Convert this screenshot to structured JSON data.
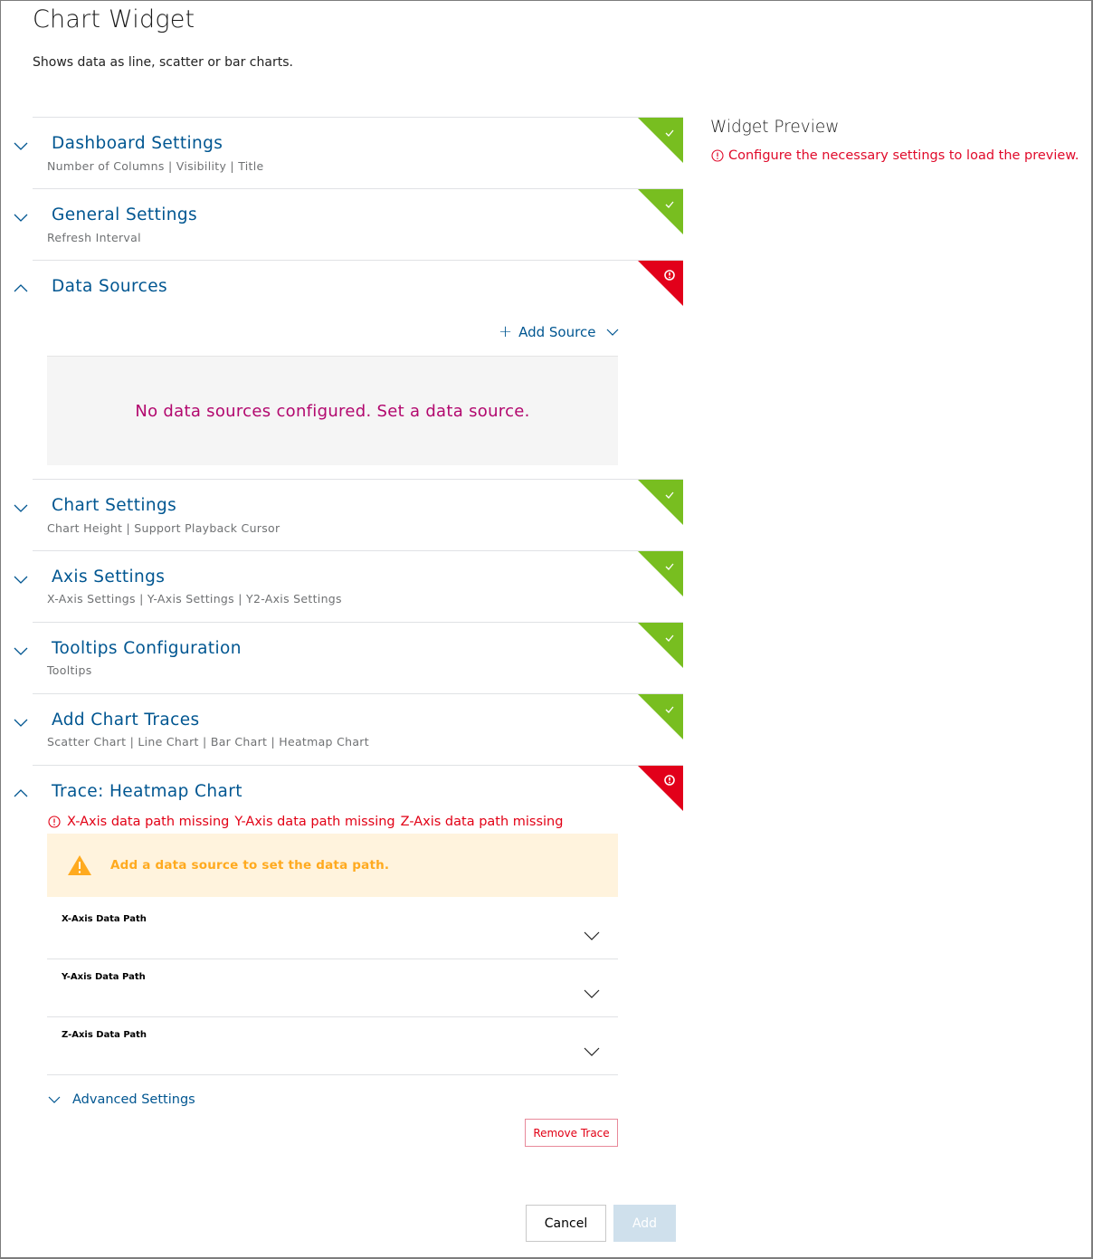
{
  "page": {
    "title": "Chart Widget",
    "subtitle": "Shows data as line, scatter or bar charts."
  },
  "colors": {
    "accent": "#005691",
    "success": "#78be20",
    "error": "#e20015",
    "warning": "#ffaa1f",
    "empty_message": "#b2076e"
  },
  "sections": [
    {
      "title": "Dashboard Settings",
      "subtitle": "Number of Columns | Visibility | Title",
      "expanded": false,
      "status": "valid",
      "status_icon": "check-icon"
    },
    {
      "title": "General Settings",
      "subtitle": "Refresh Interval",
      "expanded": false,
      "status": "valid",
      "status_icon": "check-icon"
    },
    {
      "title": "Data Sources",
      "subtitle": "",
      "expanded": true,
      "status": "error",
      "status_icon": "exclamation-icon"
    },
    {
      "title": "Chart Settings",
      "subtitle": "Chart Height | Support Playback Cursor",
      "expanded": false,
      "status": "valid",
      "status_icon": "check-icon"
    },
    {
      "title": "Axis Settings",
      "subtitle": "X-Axis Settings | Y-Axis Settings | Y2-Axis Settings",
      "expanded": false,
      "status": "valid",
      "status_icon": "check-icon"
    },
    {
      "title": "Tooltips Configuration",
      "subtitle": "Tooltips",
      "expanded": false,
      "status": "valid",
      "status_icon": "check-icon"
    },
    {
      "title": "Add Chart Traces",
      "subtitle": "Scatter Chart | Line Chart | Bar Chart | Heatmap Chart",
      "expanded": false,
      "status": "valid",
      "status_icon": "check-icon"
    },
    {
      "title": "Trace: Heatmap Chart",
      "subtitle": "",
      "expanded": true,
      "status": "error",
      "status_icon": "exclamation-icon"
    }
  ],
  "data_sources": {
    "add_source_label": "Add Source",
    "empty_message": "No data sources configured. Set a data source."
  },
  "trace": {
    "errors": [
      "X-Axis data path missing",
      "Y-Axis data path missing",
      "Z-Axis data path missing"
    ],
    "warning": "Add a data source to set the data path.",
    "fields": [
      {
        "label": "X-Axis Data Path",
        "value": ""
      },
      {
        "label": "Y-Axis Data Path",
        "value": ""
      },
      {
        "label": "Z-Axis Data Path",
        "value": ""
      }
    ],
    "advanced_label": "Advanced Settings",
    "remove_label": "Remove Trace"
  },
  "preview": {
    "title": "Widget Preview",
    "message": "Configure the necessary settings to load the preview."
  },
  "footer": {
    "cancel_label": "Cancel",
    "add_label": "Add",
    "add_disabled": true
  }
}
